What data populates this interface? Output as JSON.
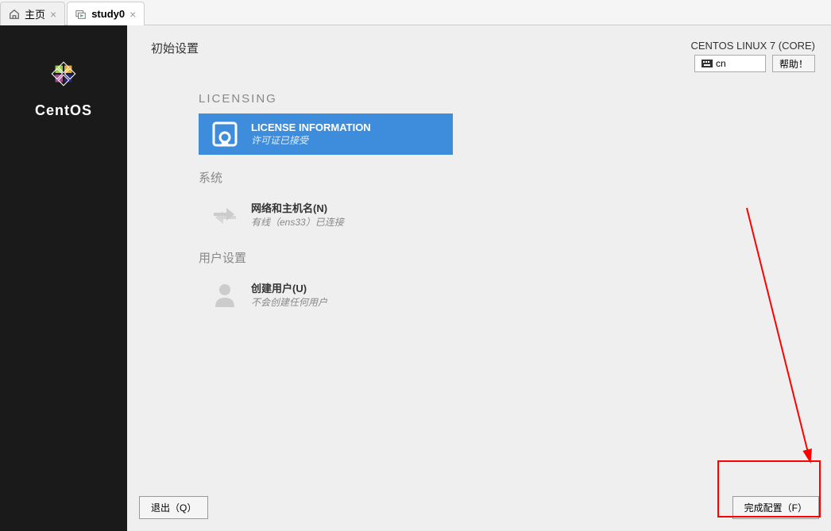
{
  "tabs": {
    "home_label": "主页",
    "vm_label": "study0"
  },
  "sidebar": {
    "brand": "CentOS"
  },
  "header": {
    "title": "初始设置",
    "os_name": "CENTOS LINUX 7 (CORE)",
    "locale": "cn",
    "help_label": "帮助！"
  },
  "sections": {
    "licensing": {
      "label": "LICENSING",
      "item_title": "LICENSE INFORMATION",
      "item_sub": "许可证已接受"
    },
    "system": {
      "label": "系统",
      "item_title": "网络和主机名(N)",
      "item_sub": "有线（ens33）已连接"
    },
    "user": {
      "label": "用户设置",
      "item_title": "创建用户(U)",
      "item_sub": "不会创建任何用户"
    }
  },
  "footer": {
    "exit_label": "退出（Q）",
    "finish_label": "完成配置（F）"
  }
}
